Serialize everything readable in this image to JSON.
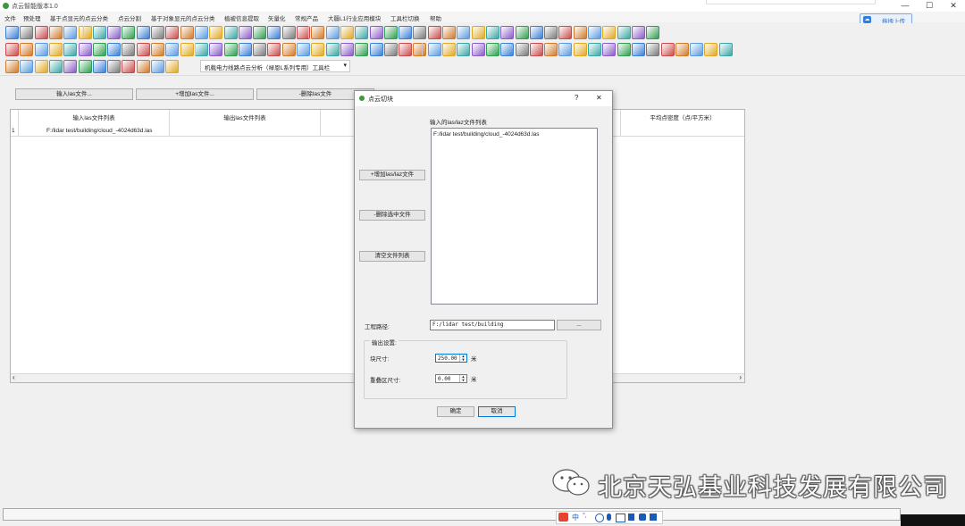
{
  "window": {
    "title": "点云智能版本1.0",
    "minimize_glyph": "—",
    "maximize_glyph": "☐",
    "close_glyph": "✕"
  },
  "menu": [
    "文件",
    "预处理",
    "基于点显元的点云分类",
    "点云分割",
    "基于对象显元的点云分类",
    "植被信息提取",
    "矢量化",
    "常规产品",
    "大疆L1行业应用模块",
    "工具栏切换",
    "帮助"
  ],
  "upload_button": {
    "label": "拖拽上传",
    "icon": "cloud-upload-icon"
  },
  "toolbar3": {
    "combo_value": "机载电力线路点云分析（禄恩L系列专用）工具栏",
    "combo_arrow": "▾"
  },
  "main": {
    "buttons": {
      "input_las": "输入las文件...",
      "add_las": "+增加las文件...",
      "remove_las": "-删除las文件"
    },
    "table": {
      "headers": [
        "输入las文件列表",
        "输出las文件列表",
        "平均点密度（点/平方米）"
      ],
      "rows": [
        {
          "index": "1",
          "input": "F:/lidar test/building/cloud_-4024d63d.las"
        }
      ]
    },
    "scroll_left": "‹",
    "scroll_right": "›"
  },
  "dialog": {
    "title": "点云切块",
    "help_glyph": "?",
    "close_glyph": "✕",
    "list_label": "输入的las/laz文件列表",
    "files": [
      "F:/lidar test/building/cloud_-4024d63d.las"
    ],
    "add_button": "+增加las/laz文件",
    "remove_button": "-删除选中文件",
    "clear_button": "清空文件列表",
    "project_path_label": "工程路径:",
    "project_path_value": "F:/lidar test/building",
    "browse_button": "...",
    "output_group_label": "输出设置:",
    "block_size_label": "块尺寸:",
    "block_size_value": "250.00",
    "block_size_unit": "米",
    "overlap_label": "重叠区尺寸:",
    "overlap_value": "0.00",
    "overlap_unit": "米",
    "ok_button": "确定",
    "cancel_button": "取消"
  },
  "watermark": {
    "text": "北京天弘基业科技发展有限公司",
    "icon": "wechat-icon"
  },
  "ime": {
    "label": "中",
    "extra": "°,"
  },
  "colors": {
    "accent_blue": "#2f7de1",
    "dialog_border": "#8f8f8f",
    "focus_blue": "#0078d7"
  }
}
